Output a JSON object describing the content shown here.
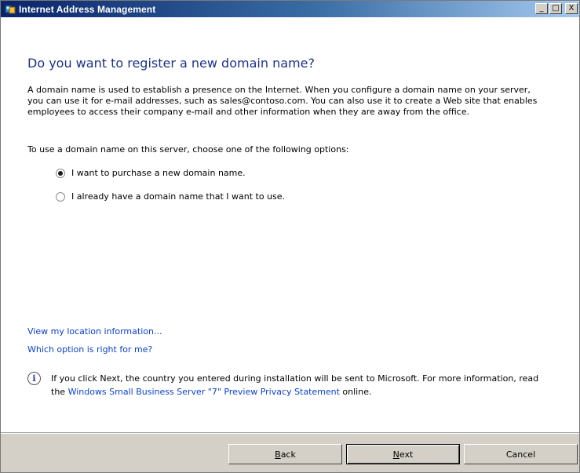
{
  "window": {
    "title": "Internet Address Management",
    "controls": {
      "minimize": "_",
      "maximize": "□",
      "close": "X"
    }
  },
  "heading": "Do you want to register a new domain name?",
  "description": "A domain name is used to establish a presence on the Internet. When you configure a domain name on your server, you can use it for e-mail addresses, such as sales@contoso.com. You can also use it to create a Web site that enables employees to access their company e-mail and other information when they are away from the office.",
  "instruction": "To use a domain name on this server, choose one of the following options:",
  "options": [
    {
      "label": "I want to purchase a new domain name.",
      "selected": true
    },
    {
      "label": "I already have a domain name that I want to use.",
      "selected": false
    }
  ],
  "links": {
    "location": "View my location information...",
    "which_option": "Which option is right for me?"
  },
  "info": {
    "icon": "info-icon",
    "text_before": "If you click Next, the country you entered during installation will be sent to Microsoft. For more information, read the ",
    "link": "Windows Small Business Server \"7\" Preview Privacy Statement",
    "text_after": " online."
  },
  "buttons": {
    "back_first": "B",
    "back_rest": "ack",
    "next_first": "N",
    "next_rest": "ext",
    "cancel": "Cancel"
  },
  "colors": {
    "heading": "#1e3287",
    "link": "#0b40c8",
    "titlebar_start": "#0a246a",
    "titlebar_end": "#a6caf0",
    "footer_bg": "#d4d0c8"
  }
}
